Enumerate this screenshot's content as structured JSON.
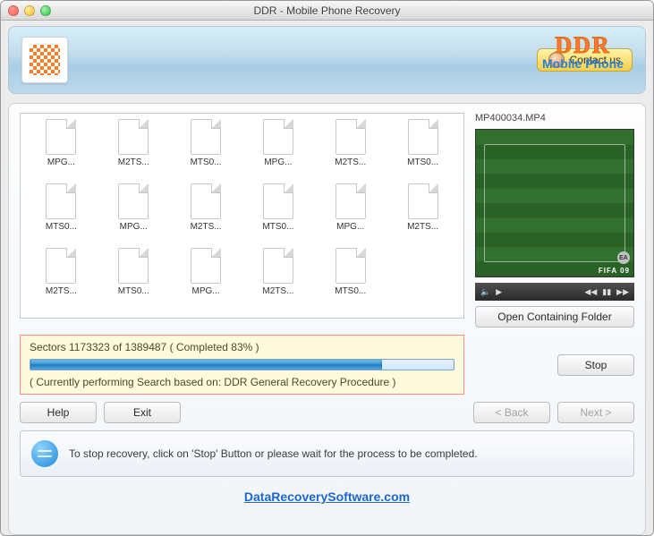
{
  "window": {
    "title": "DDR - Mobile Phone Recovery"
  },
  "banner": {
    "contact_label": "Contact us",
    "brand_top": "DDR",
    "brand_bottom": "Mobile Phone"
  },
  "files": [
    "MPG...",
    "M2TS...",
    "MTS0...",
    "MPG...",
    "M2TS...",
    "MTS0...",
    "MTS0...",
    "MPG...",
    "M2TS...",
    "MTS0...",
    "MPG...",
    "M2TS...",
    "M2TS...",
    "MTS0...",
    "MPG...",
    "M2TS...",
    "MTS0..."
  ],
  "preview": {
    "filename": "MP400034.MP4",
    "open_folder_label": "Open Containing Folder",
    "watermark": "FIFA 09",
    "ea": "EA"
  },
  "progress": {
    "sectors_line": "Sectors 1173323 of 1389487   ( Completed 83% )",
    "method_line": "( Currently performing Search based on: DDR General Recovery Procedure )",
    "percent": 83
  },
  "buttons": {
    "stop": "Stop",
    "help": "Help",
    "exit": "Exit",
    "back": "< Back",
    "next": "Next >"
  },
  "tip": "To stop recovery, click on 'Stop' Button or please wait for the process to be completed.",
  "footer_link": "DataRecoverySoftware.com"
}
